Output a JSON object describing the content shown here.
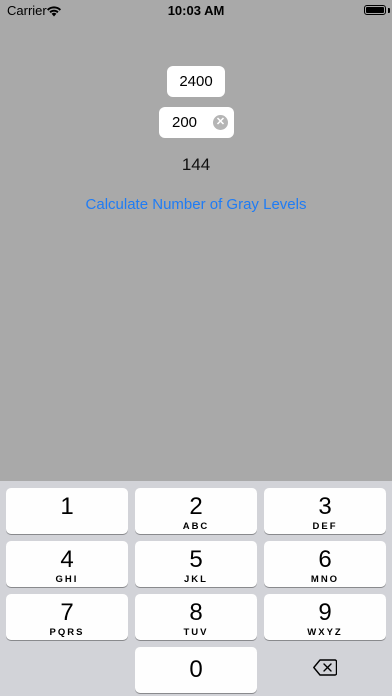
{
  "status_bar": {
    "carrier": "Carrier",
    "time": "10:03 AM"
  },
  "main": {
    "field1_value": "2400",
    "field2_value": "200",
    "result": "144",
    "calculate_label": "Calculate Number of Gray Levels"
  },
  "keypad": {
    "keys": [
      {
        "num": "1",
        "letters": ""
      },
      {
        "num": "2",
        "letters": "ABC"
      },
      {
        "num": "3",
        "letters": "DEF"
      },
      {
        "num": "4",
        "letters": "GHI"
      },
      {
        "num": "5",
        "letters": "JKL"
      },
      {
        "num": "6",
        "letters": "MNO"
      },
      {
        "num": "7",
        "letters": "PQRS"
      },
      {
        "num": "8",
        "letters": "TUV"
      },
      {
        "num": "9",
        "letters": "WXYZ"
      },
      {
        "num": "0",
        "letters": ""
      }
    ],
    "delete_icon": "backspace-icon"
  }
}
